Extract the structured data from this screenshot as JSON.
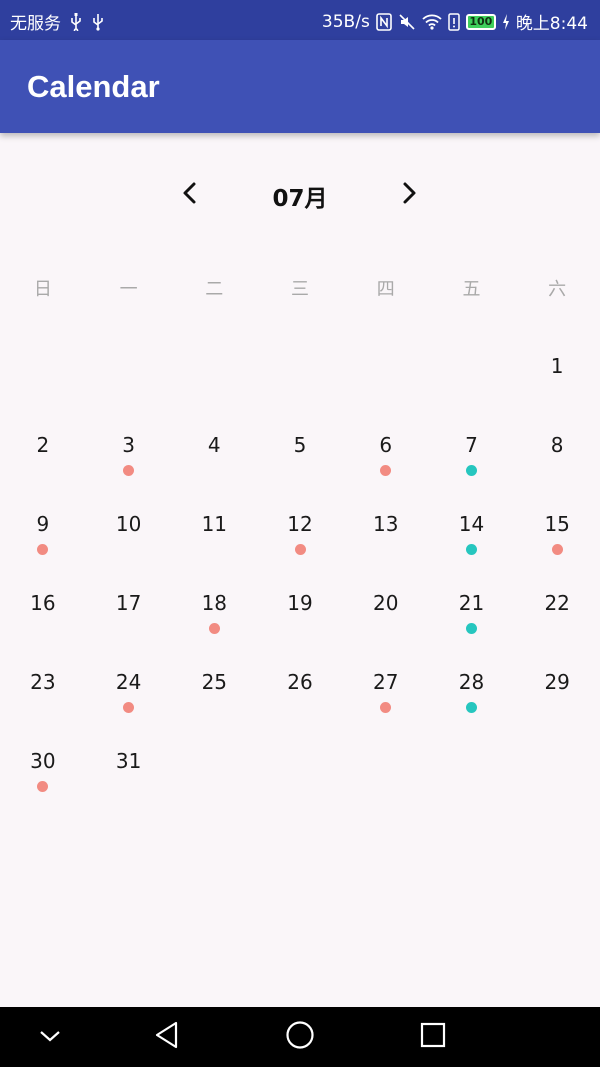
{
  "status_bar": {
    "carrier": "无服务",
    "speed": "35B/s",
    "battery": "100",
    "time": "晚上8:44"
  },
  "app_bar": {
    "title": "Calendar"
  },
  "calendar": {
    "month_label": "07月",
    "weekdays": [
      "日",
      "一",
      "二",
      "三",
      "四",
      "五",
      "六"
    ],
    "weeks": [
      [
        null,
        null,
        null,
        null,
        null,
        null,
        {
          "day": "1"
        }
      ],
      [
        {
          "day": "2"
        },
        {
          "day": "3",
          "dot": "salmon"
        },
        {
          "day": "4"
        },
        {
          "day": "5"
        },
        {
          "day": "6",
          "dot": "salmon"
        },
        {
          "day": "7",
          "dot": "teal"
        },
        {
          "day": "8"
        }
      ],
      [
        {
          "day": "9",
          "dot": "salmon"
        },
        {
          "day": "10"
        },
        {
          "day": "11"
        },
        {
          "day": "12",
          "dot": "salmon"
        },
        {
          "day": "13"
        },
        {
          "day": "14",
          "dot": "teal"
        },
        {
          "day": "15",
          "dot": "salmon"
        }
      ],
      [
        {
          "day": "16"
        },
        {
          "day": "17"
        },
        {
          "day": "18",
          "dot": "salmon"
        },
        {
          "day": "19"
        },
        {
          "day": "20"
        },
        {
          "day": "21",
          "dot": "teal"
        },
        {
          "day": "22"
        }
      ],
      [
        {
          "day": "23"
        },
        {
          "day": "24",
          "dot": "salmon"
        },
        {
          "day": "25"
        },
        {
          "day": "26"
        },
        {
          "day": "27",
          "dot": "salmon"
        },
        {
          "day": "28",
          "dot": "teal"
        },
        {
          "day": "29"
        }
      ],
      [
        {
          "day": "30",
          "dot": "salmon"
        },
        {
          "day": "31"
        },
        null,
        null,
        null,
        null,
        null
      ]
    ]
  },
  "colors": {
    "status_bar": "#2f3f9e",
    "app_bar": "#3f51b5",
    "background": "#faf6f9",
    "dot_salmon": "#f28b82",
    "dot_teal": "#26c6bf"
  },
  "icons": {
    "prev": "chevron-left-icon",
    "next": "chevron-right-icon",
    "nav_down": "chevron-down-icon",
    "nav_back": "back-triangle-icon",
    "nav_home": "home-circle-icon",
    "nav_recents": "recents-square-icon"
  }
}
